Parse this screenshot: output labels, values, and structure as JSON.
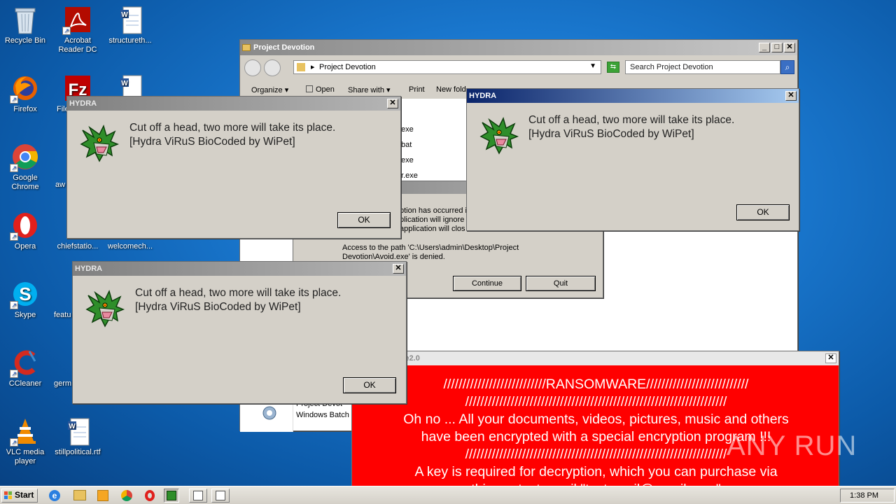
{
  "desktop": {
    "icons": [
      {
        "label": "Recycle Bin"
      },
      {
        "label": "Acrobat Reader DC"
      },
      {
        "label": "structureth..."
      },
      {
        "label": "Firefox"
      },
      {
        "label": "File"
      },
      {
        "label": "Google Chrome"
      },
      {
        "label": "aw"
      },
      {
        "label": "Opera"
      },
      {
        "label": "chiefstatio..."
      },
      {
        "label": "welcomech..."
      },
      {
        "label": "Skype"
      },
      {
        "label": "featu"
      },
      {
        "label": "CCleaner"
      },
      {
        "label": "germ"
      },
      {
        "label": "VLC media player"
      },
      {
        "label": "stillpolitical.rtf"
      }
    ]
  },
  "explorer": {
    "title": "Project Devotion",
    "address": "Project Devotion",
    "search_placeholder": "Search Project Devotion",
    "toolbar": {
      "organize": "Organize",
      "open": "Open",
      "share_with": "Share with",
      "print": "Print",
      "new_folder": "New fold"
    },
    "files": [
      "exe",
      "bat",
      "exe",
      "r.exe"
    ],
    "bottom_file_1": "Project Devot",
    "bottom_file_2": "Windows Batch"
  },
  "error_dialog": {
    "lines": [
      "ption has occurred in",
      "plication will ignore th",
      "application will clos"
    ],
    "message": "Access to the path 'C:\\Users\\admin\\Desktop\\Project Devotion\\Avoid.exe' is denied.",
    "continue_label": "Continue",
    "quit_label": "Quit"
  },
  "hydra": {
    "title": "HYDRA",
    "line1": "Cut off a head, two more will take its place.",
    "line2": "[Hydra ViRuS BioCoded by WiPet]",
    "ok_label": "OK"
  },
  "ransomware": {
    "title": "are2.0",
    "lines": [
      "///////////////////////////RANSOMWARE///////////////////////////",
      "/////////////////////////////////////////////////////////////////////",
      "Oh no ... All your documents, videos, pictures, music and others",
      "have been encrypted with a special encryption program !!!",
      "/////////////////////////////////////////////////////////////////////",
      "A key is required for decryption, which you can purchase via",
      "this contact email \"testemail@gmail.com\"",
      "/////////////////////////////////////////////////////////////////////"
    ]
  },
  "watermark": {
    "text": "ANY RUN"
  },
  "taskbar": {
    "start_label": "Start",
    "clock": "1:38 PM"
  }
}
